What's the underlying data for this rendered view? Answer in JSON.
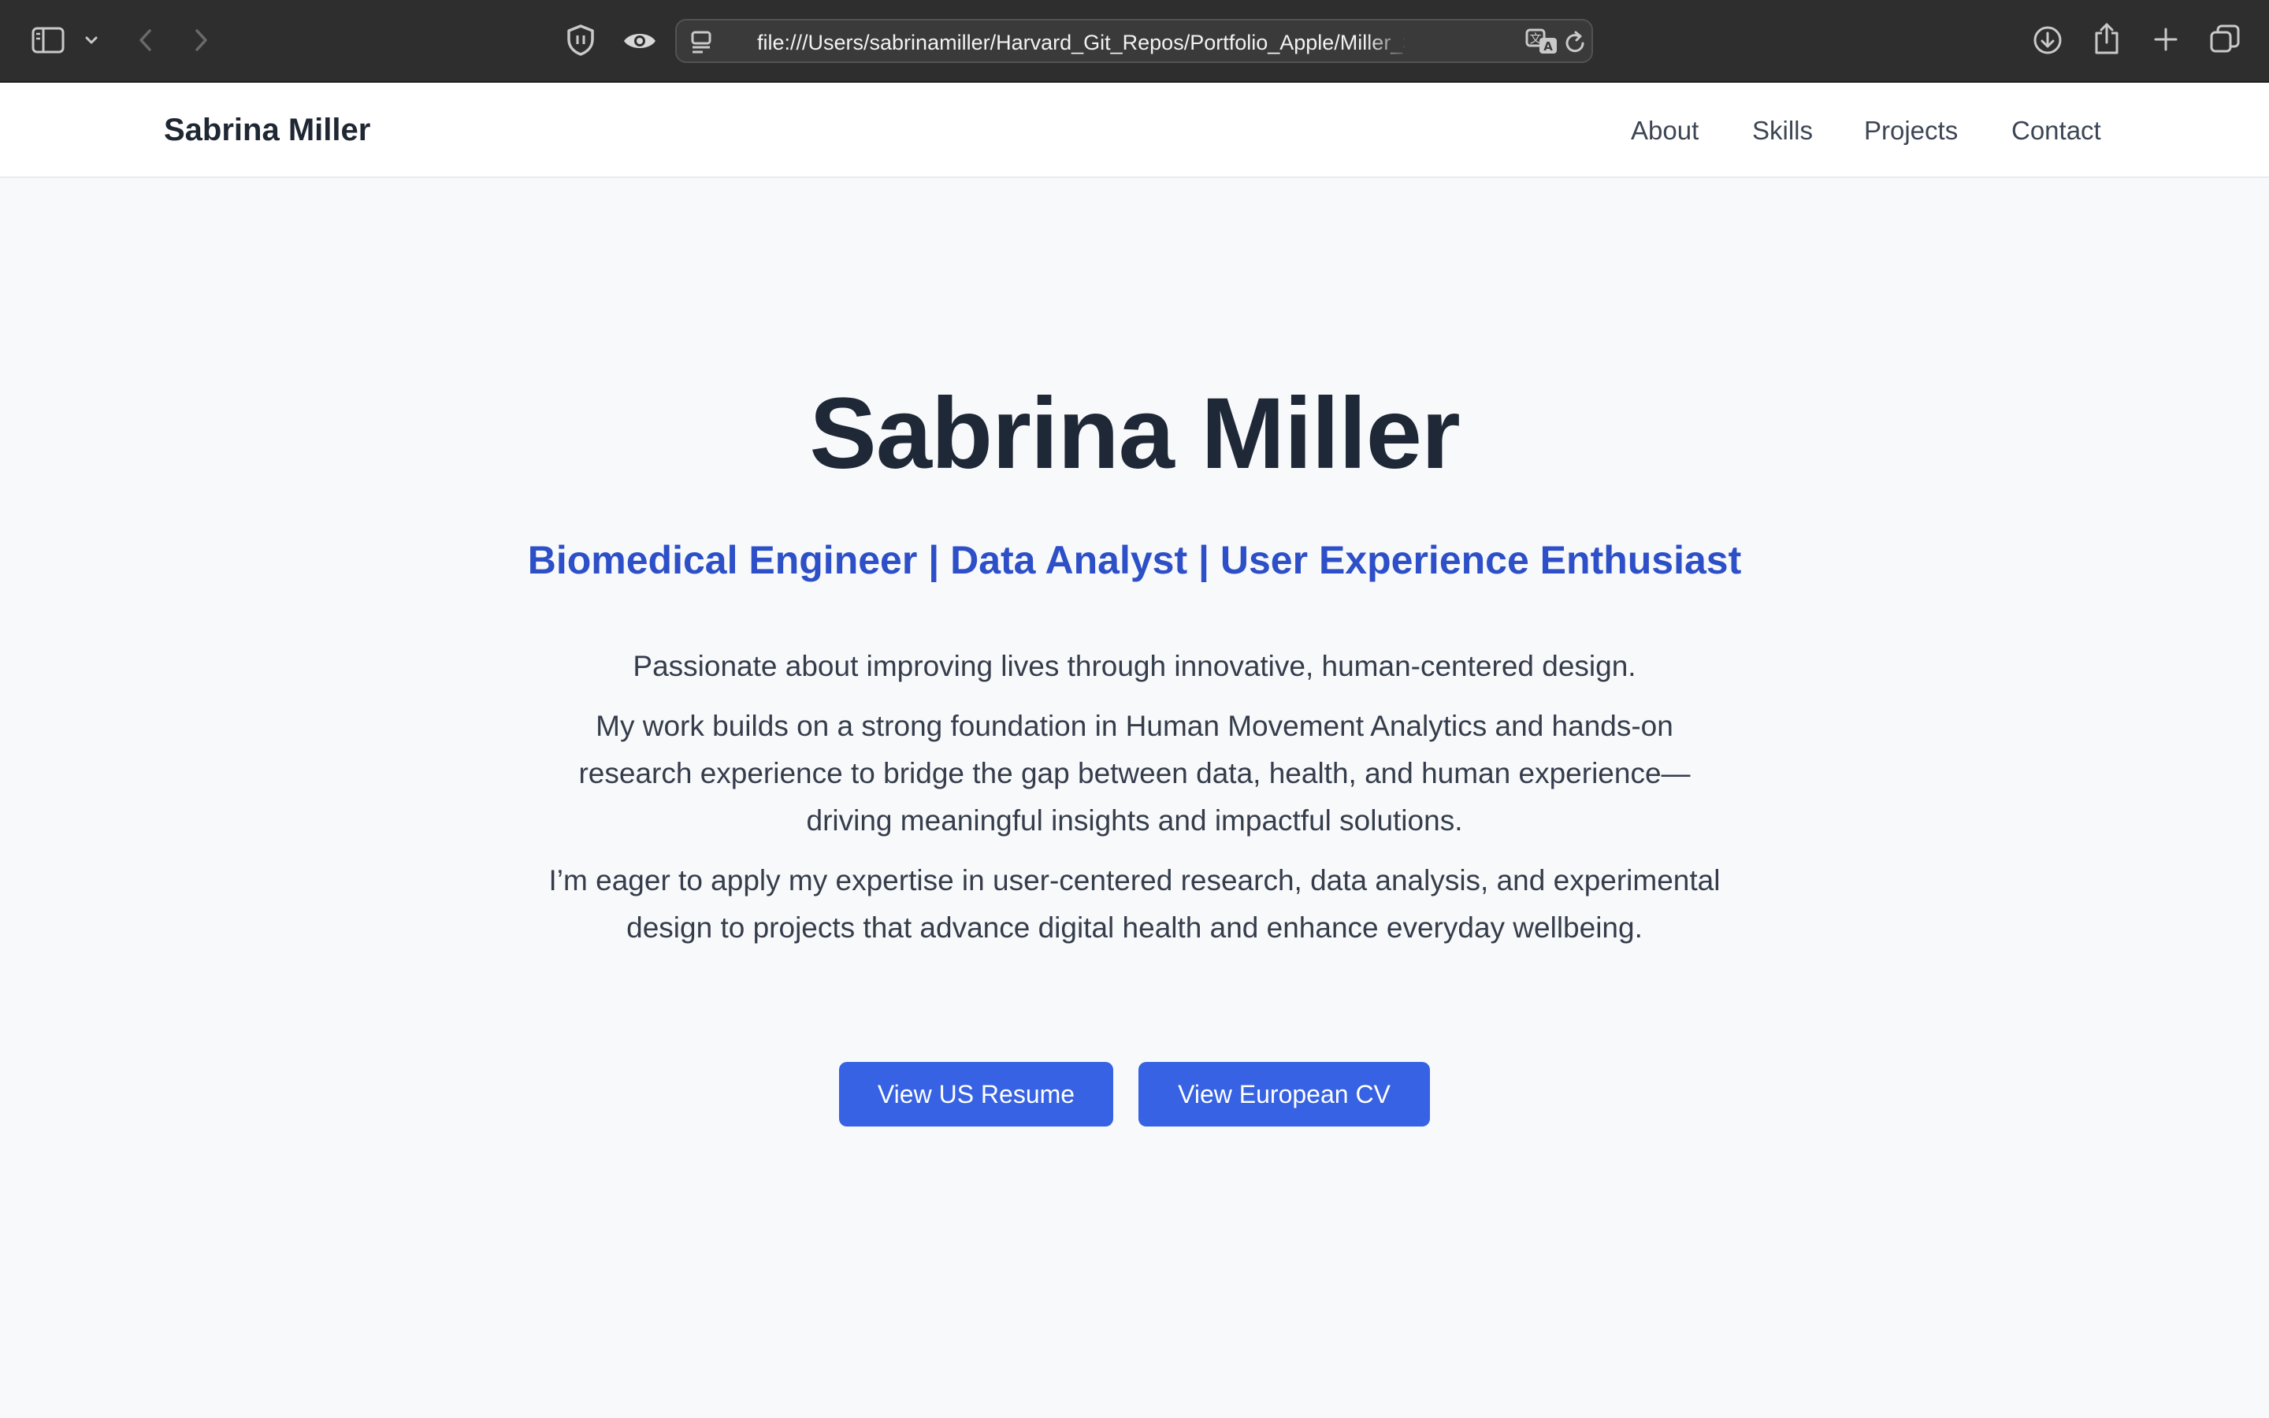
{
  "browser": {
    "url": "file:///Users/sabrinamiller/Harvard_Git_Repos/Portfolio_Apple/Miller_Sabrina_Portfolio",
    "icons": [
      "sidebar-icon",
      "chevron-down-icon",
      "back-arrow-icon",
      "forward-arrow-icon",
      "shield-icon",
      "eye-icon",
      "page-menu-icon",
      "translate-icon",
      "reload-icon",
      "download-icon",
      "share-icon",
      "plus-icon",
      "tabs-overview-icon"
    ]
  },
  "header": {
    "brand": "Sabrina Miller",
    "nav": [
      "About",
      "Skills",
      "Projects",
      "Contact"
    ]
  },
  "hero": {
    "title": "Sabrina Miller",
    "subtitle": "Biomedical Engineer | Data Analyst | User Experience Enthusiast",
    "paragraphs": [
      "Passionate about improving lives through innovative, human-centered design.",
      "My work builds on a strong foundation in Human Movement Analytics and hands-on research experience to bridge the gap between data, health, and human experience—driving meaningful insights and impactful solutions.",
      "I’m eager to apply my expertise in user-centered research, data analysis, and experimental design to projects that advance digital health and enhance everyday wellbeing."
    ],
    "buttons": [
      "View US Resume",
      "View European CV"
    ]
  },
  "colors": {
    "toolbar": "#2e2e2e",
    "page_background": "#f8f9fb",
    "title": "#1f2837",
    "subtitle": "#2d4fc7",
    "button": "#3662e3"
  }
}
